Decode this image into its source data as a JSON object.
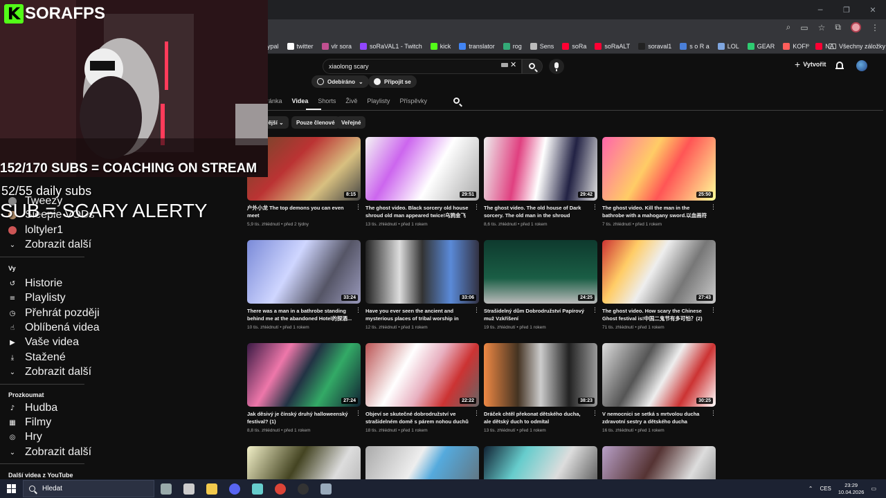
{
  "bookmarks": [
    {
      "label": "ypal",
      "color": "#9aa0a6"
    },
    {
      "label": "twitter",
      "icon": "x-icon",
      "color": "#ffffff"
    },
    {
      "label": "vlr sora",
      "icon": "vlr-icon",
      "color": "#c05090"
    },
    {
      "label": "soRaVAL1 - Twitch",
      "icon": "twitch-icon",
      "color": "#9146ff"
    },
    {
      "label": "kick",
      "icon": "kick-icon",
      "color": "#53fc18"
    },
    {
      "label": "translator",
      "icon": "google-icon",
      "color": "#4285f4"
    },
    {
      "label": "rog",
      "icon": "rog-icon",
      "color": "#3a7"
    },
    {
      "label": "Sens",
      "icon": "sens-icon",
      "color": "#bbbbbb"
    },
    {
      "label": "soRa",
      "icon": "yt-icon",
      "color": "#ff0033"
    },
    {
      "label": "soRaALT",
      "icon": "yt-icon",
      "color": "#ff0033"
    },
    {
      "label": "soraval1",
      "icon": "tiktok-icon",
      "color": "#222222"
    },
    {
      "label": "s o R a",
      "icon": "generic-icon",
      "color": "#4a7fd8"
    },
    {
      "label": "LOL",
      "icon": "lol-icon",
      "color": "#7fa6e0"
    },
    {
      "label": "GEAR",
      "icon": "gear-bm-icon",
      "color": "#2ecc71"
    },
    {
      "label": "KOFI",
      "icon": "kofi-icon",
      "color": "#ff5e5b"
    },
    {
      "label": "NA",
      "icon": "yt-icon",
      "color": "#ff0033"
    }
  ],
  "bookmarks_all": "Všechny záložky",
  "search": {
    "query": "xiaolong scary"
  },
  "header": {
    "create_label": "Vytvořit"
  },
  "channel_buttons": {
    "subscribed": "Odebíráno",
    "join": "Připojit se"
  },
  "tabs": [
    "ká stránka",
    "Videa",
    "Shorts",
    "Živě",
    "Playlisty",
    "Příspěvky"
  ],
  "filters": [
    "vější",
    "Pouze členové",
    "Veřejné"
  ],
  "videos": [
    {
      "title": "户外小龙 The top demons you can even meet",
      "meta": "5,9 tis. zhlédnutí • před 2 týdny",
      "duration": "8:15",
      "bg": "linear-gradient(135deg,#6a4a2a,#b33 40%,#d8c080 70%,#444)"
    },
    {
      "title": "The ghost video. Black sorcery old house shroud old man appeared twice!乌鸦金飞机...",
      "meta": "13 tis. zhlédnutí • před 1 rokem",
      "duration": "29:51",
      "bg": "linear-gradient(120deg,#f4f4f4,#c6e,#fff 60%,#aaa)"
    },
    {
      "title": "The ghost video. The old house of Dark sorcery. The old man in the shroud passed...",
      "meta": "8,6 tis. zhlédnutí • před 1 rokem",
      "duration": "29:42",
      "bg": "linear-gradient(100deg,#eee,#e04080 30%,#fff 50%,#224 75%,#ddd)"
    },
    {
      "title": "The ghost video. Kill the man in the bathrobe with a mahogany sword.以血画符困住浴袍...",
      "meta": "7 tis. zhlédnutí • před 1 rokem",
      "duration": "25:50",
      "bg": "linear-gradient(120deg,#f6a,#fc6 40%,#f55 60%,#ff9)"
    },
    {
      "title": "There was a man in a bathrobe standing behind me at the abandoned Hotel的探酒...",
      "meta": "10 tis. zhlédnutí • před 1 rokem",
      "duration": "33:24",
      "bg": "linear-gradient(120deg,#7a8ad8,#cfd6ff 40%,#556 70%,#99b)"
    },
    {
      "title": "Have you ever seen the ancient and mysterious places of tribal worship in Chin...",
      "meta": "12 tis. zhlédnutí • před 1 rokem",
      "duration": "33:06",
      "bg": "linear-gradient(90deg,#222,#ddd 30%,#333 50%,#5a8ad8 75%,#334)"
    },
    {
      "title": "Strašidelný dům Dobrodružství Papírový muž Vzkříšení",
      "meta": "19 tis. zhlédnutí • před 1 rokem",
      "duration": "24:25",
      "bg": "linear-gradient(180deg,#0e3a2e,#1a5e45 60%,#bbb)"
    },
    {
      "title": "The ghost video. How scary the Chinese Ghost festival is!中国二鬼节有多可怕？(2)",
      "meta": "71 tis. zhlédnutí • před 1 rokem",
      "duration": "27:43",
      "bg": "linear-gradient(120deg,#c33,#fc6 25%,#eee 45%,#777 70%,#ccc)"
    },
    {
      "title": "Jak děsivý je čínský druhý halloweenský festival? (1)",
      "meta": "8,8 tis. zhlédnutí • před 1 rokem",
      "duration": "27:24",
      "bg": "linear-gradient(120deg,#3a1a44,#e7a 30%,#234 50%,#3a6 70%,#123)"
    },
    {
      "title": "Objeví se skutečné dobrodružství ve strašidelném domě s párem nohou duchů",
      "meta": "18 tis. zhlédnutí • před 1 rokem",
      "duration": "22:22",
      "bg": "linear-gradient(120deg,#b55,#fff 35%,#e8b0c0 55%,#c33 75%,#666)"
    },
    {
      "title": "Dráček chtěl překonat dětského ducha, ale dětský duch to odmítal",
      "meta": "13 tis. zhlédnutí • před 1 rokem",
      "duration": "38:23",
      "bg": "linear-gradient(90deg,#e84,#432 30%,#ccc 50%,#222 75%,#999)"
    },
    {
      "title": "V nemocnici se setká s mrtvolou ducha zdravotní sestry a dětského ducha",
      "meta": "16 tis. zhlédnutí • před 1 rokem",
      "duration": "30:25",
      "bg": "linear-gradient(120deg,#ddd,#555 35%,#eee 55%,#c33 75%,#fff)"
    },
    {
      "title": "",
      "meta": "",
      "duration": "",
      "bg": "linear-gradient(120deg,#f2f0c8,#442 40%,#ddd 70%,#aaa)"
    },
    {
      "title": "",
      "meta": "",
      "duration": "",
      "bg": "linear-gradient(120deg,#aaa,#eee 40%,#5ad 55%,#666)"
    },
    {
      "title": "",
      "meta": "",
      "duration": "",
      "bg": "linear-gradient(120deg,#123,#6cc 30%,#ddd 60%,#333)"
    },
    {
      "title": "",
      "meta": "",
      "duration": "",
      "bg": "linear-gradient(120deg,#b8a0c8,#533 40%,#ddd 70%,#777)"
    }
  ],
  "sidebar": {
    "subs": [
      {
        "label": "Tweezy",
        "color": "#888"
      },
      {
        "label": "Sleepie VODs",
        "color": "#a86"
      },
      {
        "label": "loltyler1",
        "color": "#c55"
      }
    ],
    "show_more": "Zobrazit další",
    "you_heading": "Vy",
    "you_items": [
      {
        "label": "Historie",
        "icon": "history-icon",
        "glyph": "↺"
      },
      {
        "label": "Playlisty",
        "icon": "playlists-icon",
        "glyph": "≡"
      },
      {
        "label": "Přehrát později",
        "icon": "watch-later-icon",
        "glyph": "◷"
      },
      {
        "label": "Oblíbená videa",
        "icon": "liked-icon",
        "glyph": "☝"
      },
      {
        "label": "Vaše videa",
        "icon": "your-videos-icon",
        "glyph": "▶"
      },
      {
        "label": "Stažené",
        "icon": "downloads-icon",
        "glyph": "⤓"
      },
      {
        "label": "Zobrazit další",
        "icon": "chevron-down-icon",
        "glyph": "⌄"
      }
    ],
    "explore_heading": "Prozkoumat",
    "explore_items": [
      {
        "label": "Hudba",
        "icon": "music-icon",
        "glyph": "♪"
      },
      {
        "label": "Filmy",
        "icon": "movies-icon",
        "glyph": "▦"
      },
      {
        "label": "Hry",
        "icon": "games-icon",
        "glyph": "◎"
      },
      {
        "label": "Zobrazit další",
        "icon": "chevron-down-icon",
        "glyph": "⌄"
      }
    ],
    "more_heading": "Další videa z YouTube"
  },
  "overlay": {
    "logo_k": "K",
    "logo_text": "SORAFPS",
    "line1": "152/170 SUBS = COACHING ON STREAM",
    "line2": "52/55 daily subs",
    "line3": "SUB = SCARY ALERTY"
  },
  "taskbar": {
    "search": "Hledat",
    "lang": "CES",
    "time": "23:29",
    "date": "10.04.2026",
    "apps": [
      {
        "icon": "taskview-icon",
        "color": "#9aa"
      },
      {
        "icon": "explorer-icon",
        "color": "#ccc"
      },
      {
        "icon": "files-icon",
        "color": "#f2c94c"
      },
      {
        "icon": "discord-icon",
        "color": "#5865f2"
      },
      {
        "icon": "app-icon",
        "color": "#6cc"
      },
      {
        "icon": "chrome-icon",
        "color": "#db4437"
      },
      {
        "icon": "obs-icon",
        "color": "#333"
      },
      {
        "icon": "app2-icon",
        "color": "#9ab"
      }
    ]
  }
}
